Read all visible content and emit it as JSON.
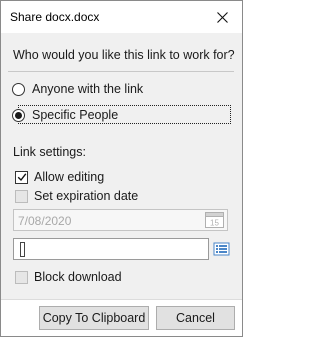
{
  "window": {
    "title": "Share docx.docx",
    "close_icon": "close-icon"
  },
  "share": {
    "question": "Who would you like this link to work for?",
    "options": [
      {
        "label": "Anyone with the link",
        "checked": false
      },
      {
        "label": "Specific People",
        "checked": true
      }
    ]
  },
  "settings": {
    "label": "Link settings:",
    "allow_editing": {
      "label": "Allow editing",
      "checked": true
    },
    "set_expiration": {
      "label": "Set expiration date",
      "checked": false,
      "enabled": false
    },
    "expiration_date": {
      "value": "7/08/2020",
      "enabled": false
    },
    "calendar_icon": "calendar-icon",
    "calendar_day": "15",
    "people_input": {
      "value": ""
    },
    "address_book_icon": "address-book-icon",
    "block_download": {
      "label": "Block download",
      "checked": false,
      "enabled": false
    }
  },
  "buttons": {
    "copy": "Copy To Clipboard",
    "cancel": "Cancel"
  },
  "colors": {
    "dialog_bg": "#f0f0f0",
    "titlebar_bg": "#ffffff",
    "button_bg": "#e1e1e1",
    "disabled_text": "#a8a8a8",
    "accent_blue": "#4a86c8"
  }
}
